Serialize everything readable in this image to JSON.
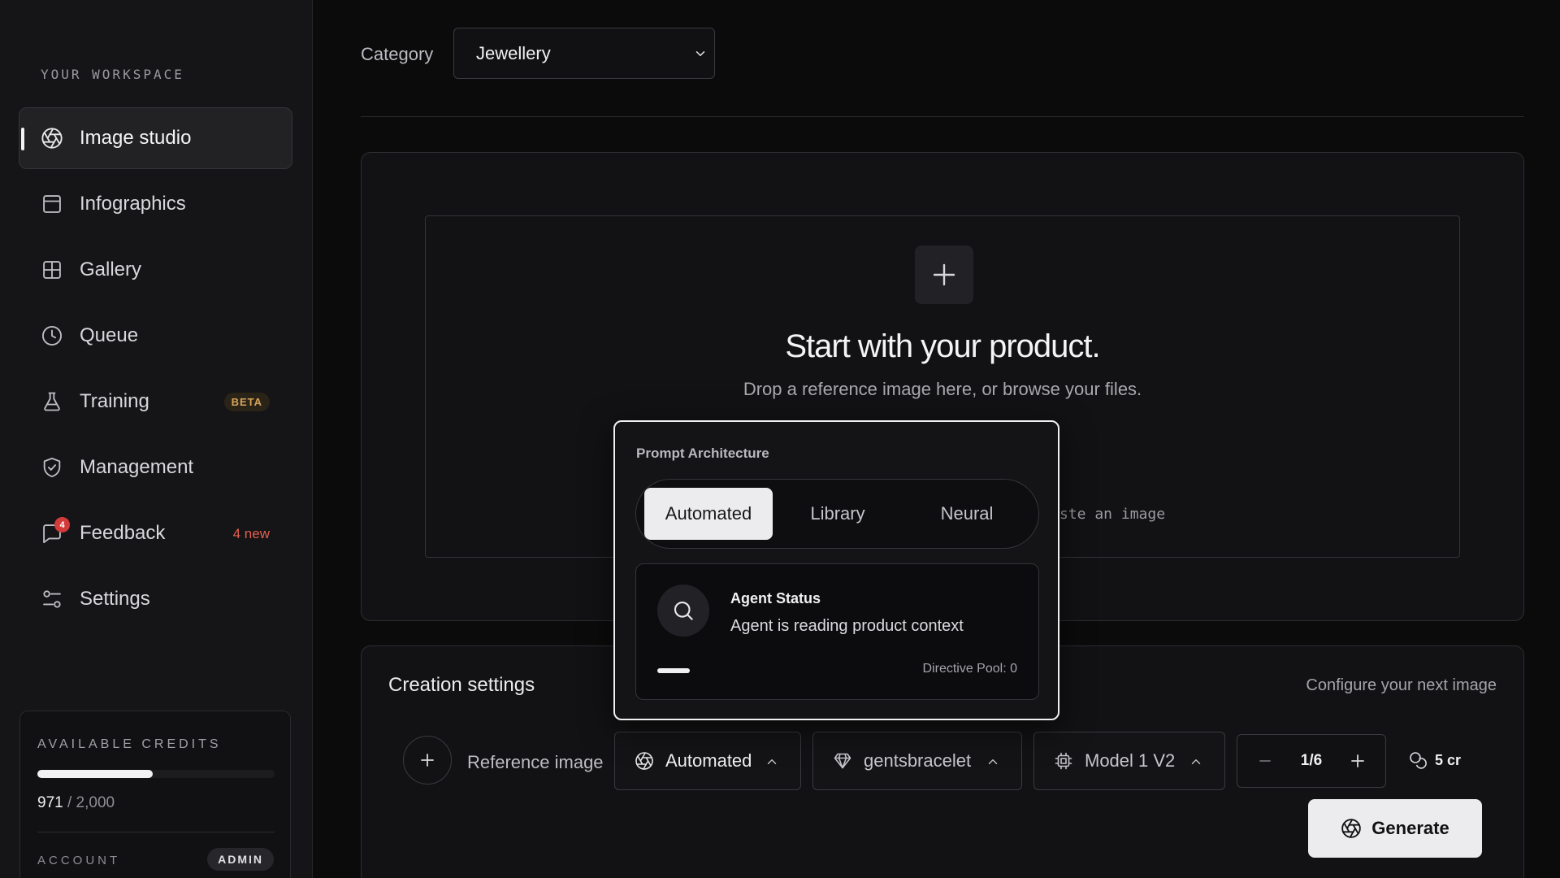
{
  "sidebar": {
    "workspace_label": "YOUR WORKSPACE",
    "items": [
      {
        "label": "Image studio",
        "icon": "aperture-icon",
        "active": true
      },
      {
        "label": "Infographics",
        "icon": "layout-icon"
      },
      {
        "label": "Gallery",
        "icon": "grid-icon"
      },
      {
        "label": "Queue",
        "icon": "clock-icon"
      },
      {
        "label": "Training",
        "icon": "flask-icon",
        "badge": "BETA"
      },
      {
        "label": "Management",
        "icon": "shield-check-icon"
      },
      {
        "label": "Feedback",
        "icon": "message-icon",
        "notification_count": "4",
        "tag": "4 new"
      },
      {
        "label": "Settings",
        "icon": "sliders-icon"
      }
    ],
    "credits": {
      "label": "AVAILABLE CREDITS",
      "used": "971",
      "total": "/ 2,000",
      "fraction": 0.4855
    },
    "account": {
      "label": "ACCOUNT",
      "role": "ADMIN"
    }
  },
  "main": {
    "category": {
      "label": "Category",
      "value": "Jewellery"
    },
    "upload": {
      "title": "Start with your product.",
      "subtitle": "Drop a reference image here, or browse your files.",
      "paste_hint": "ste an image"
    },
    "settings": {
      "title": "Creation settings",
      "subtitle": "Configure your next image",
      "reference_label": "Reference image",
      "mode": "Automated",
      "subject": "gentsbracelet",
      "model": "Model 1 V2",
      "count": "1/6",
      "cost": "5 cr",
      "generate_label": "Generate"
    }
  },
  "popover": {
    "title": "Prompt Architecture",
    "tabs": [
      "Automated",
      "Library",
      "Neural"
    ],
    "active_tab": "Automated",
    "status_heading": "Agent Status",
    "status_text": "Agent is reading product context",
    "directive_pool": "Directive Pool: 0"
  },
  "colors": {
    "background": "#0b0b0c",
    "sidebar": "#151517",
    "accent": "#ececee",
    "beta": "#d7a45a",
    "alert": "#d33b3b"
  }
}
